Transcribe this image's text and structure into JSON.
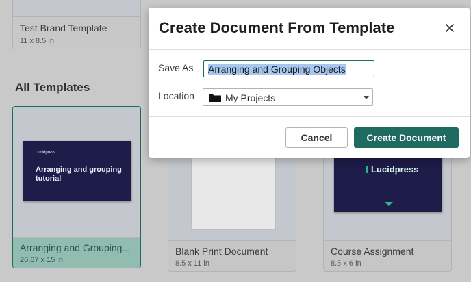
{
  "background_templates": {
    "top_card": {
      "title": "Test Brand Template",
      "size": "11 x 8.5 in"
    },
    "section_title": "All Templates",
    "cards": [
      {
        "title": "Arranging and Grouping...",
        "size": "26.67 x 15 in",
        "thumb_brand": "Lucidpress",
        "thumb_headline": "Arranging and grouping tutorial",
        "selected": true
      },
      {
        "title": "Blank Print Document",
        "size": "8.5 x 11 in"
      },
      {
        "title": "Course Assignment",
        "size": "8.5 x 6 in",
        "thumb_logo": "Lucidpress"
      }
    ]
  },
  "modal": {
    "title": "Create Document From Template",
    "close_icon": "close-icon",
    "save_as": {
      "label": "Save As",
      "value": "Arranging and Grouping Objects"
    },
    "location": {
      "label": "Location",
      "selected": "My Projects",
      "icon": "folder-icon"
    },
    "buttons": {
      "cancel": "Cancel",
      "create": "Create Document"
    }
  },
  "colors": {
    "accent": "#1f6b5f",
    "overlay_bg": "#c9c9c9",
    "slide_bg": "#1e1c48",
    "selected_meta": "#93bcb0"
  }
}
